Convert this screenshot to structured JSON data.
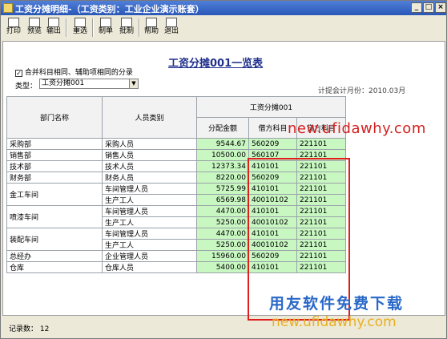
{
  "window": {
    "title": "工资分摊明细-（工资类别：工业企业演示账套）",
    "buttons": {
      "minimize": "_",
      "maximize": "□",
      "close": "×"
    }
  },
  "toolbar": {
    "items": [
      {
        "label": "打印",
        "icon": "print-icon"
      },
      {
        "label": "预览",
        "icon": "preview-icon"
      },
      {
        "label": "输出",
        "icon": "export-icon"
      },
      {
        "label": "重选",
        "icon": "reselect-icon"
      },
      {
        "label": "制单",
        "icon": "voucher-icon"
      },
      {
        "label": "批制",
        "icon": "batch-voucher-icon"
      },
      {
        "label": "帮助",
        "icon": "help-icon"
      },
      {
        "label": "退出",
        "icon": "exit-icon"
      }
    ]
  },
  "report": {
    "title": "工资分摊001一览表",
    "merge_option": "合并科目相同、辅助项相同的分录",
    "merge_checked": "✓",
    "type_label": "类型：",
    "type_value": "工资分摊001",
    "date_info": "计提会计月份：2010.03月"
  },
  "table": {
    "headers": {
      "dept": "部门名称",
      "category": "人员类别",
      "group": "工资分摊001",
      "amount": "分配金额",
      "debit": "借方科目",
      "credit": "贷方科目"
    },
    "rows": [
      {
        "dept": "采购部",
        "category": "采购人员",
        "amount": "9544.67",
        "debit": "560209",
        "credit": "221101"
      },
      {
        "dept": "销售部",
        "category": "销售人员",
        "amount": "10500.00",
        "debit": "560107",
        "credit": "221101"
      },
      {
        "dept": "技术部",
        "category": "技术人员",
        "amount": "12373.34",
        "debit": "410101",
        "credit": "221101"
      },
      {
        "dept": "财务部",
        "category": "财务人员",
        "amount": "8220.00",
        "debit": "560209",
        "credit": "221101"
      },
      {
        "dept": "金工车间",
        "category": "车间管理人员",
        "amount": "5725.99",
        "debit": "410101",
        "credit": "221101"
      },
      {
        "dept": "",
        "category": "生产工人",
        "amount": "6569.98",
        "debit": "40010102",
        "credit": "221101"
      },
      {
        "dept": "喷漆车间",
        "category": "车间管理人员",
        "amount": "4470.00",
        "debit": "410101",
        "credit": "221101"
      },
      {
        "dept": "",
        "category": "生产工人",
        "amount": "5250.00",
        "debit": "40010102",
        "credit": "221101"
      },
      {
        "dept": "装配车间",
        "category": "车间管理人员",
        "amount": "4470.00",
        "debit": "410101",
        "credit": "221101"
      },
      {
        "dept": "",
        "category": "生产工人",
        "amount": "5250.00",
        "debit": "40010102",
        "credit": "221101"
      },
      {
        "dept": "总经办",
        "category": "企业管理人员",
        "amount": "15960.00",
        "debit": "560209",
        "credit": "221101"
      },
      {
        "dept": "仓库",
        "category": "仓库人员",
        "amount": "5400.00",
        "debit": "410101",
        "credit": "221101"
      }
    ]
  },
  "status": {
    "record_count": "记录数：  12"
  },
  "watermark": {
    "url_top": "new.ufidawhy.com",
    "brand": "用友软件免费下载",
    "url_bottom": "new.ufidawhy.com"
  },
  "colors": {
    "cell_green": "#c8f7c2",
    "highlight_red": "#e01e1e",
    "title_blue": "#1f2f8c"
  }
}
